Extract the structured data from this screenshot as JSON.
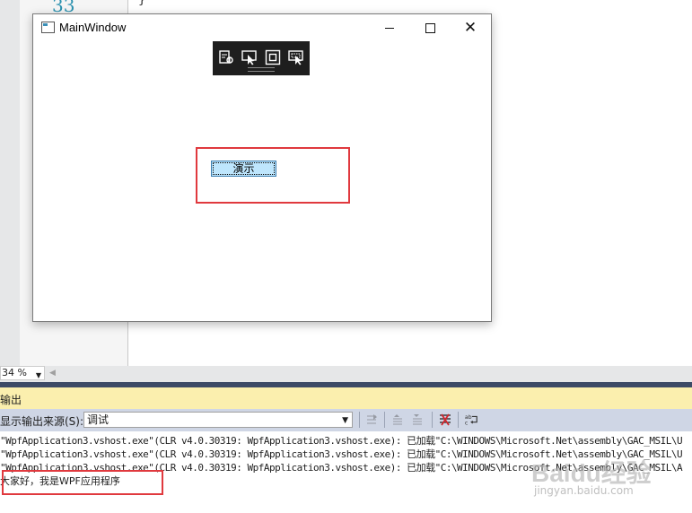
{
  "editor": {
    "line_number": "33",
    "code_fragment": "}"
  },
  "main_window": {
    "title": "MainWindow",
    "demo_button_label": "演示"
  },
  "debug_toolbar": {
    "icons": [
      "live-visual-tree-icon",
      "select-element-icon",
      "display-layout-adorners-icon",
      "track-focus-icon"
    ]
  },
  "zoom": {
    "value": "34 %"
  },
  "output_panel": {
    "title": "输出",
    "source_label": "显示输出来源(S):",
    "source_value": "调试",
    "lines": [
      "\"WpfApplication3.vshost.exe\"(CLR v4.0.30319: WpfApplication3.vshost.exe): 已加载\"C:\\WINDOWS\\Microsoft.Net\\assembly\\GAC_MSIL\\U",
      "\"WpfApplication3.vshost.exe\"(CLR v4.0.30319: WpfApplication3.vshost.exe): 已加载\"C:\\WINDOWS\\Microsoft.Net\\assembly\\GAC_MSIL\\U",
      "\"WpfApplication3.vshost.exe\"(CLR v4.0.30319: WpfApplication3.vshost.exe): 已加载\"C:\\WINDOWS\\Microsoft.Net\\assembly\\GAC_MSIL\\A"
    ],
    "app_message": "大家好，我是WPF应用程序"
  },
  "watermark": {
    "brand": "Baidu经验",
    "url": "jingyan.baidu.com"
  },
  "colors": {
    "highlight_red": "#e0393e",
    "panel_header": "#fbefae",
    "button_face": "#bee6fd"
  }
}
